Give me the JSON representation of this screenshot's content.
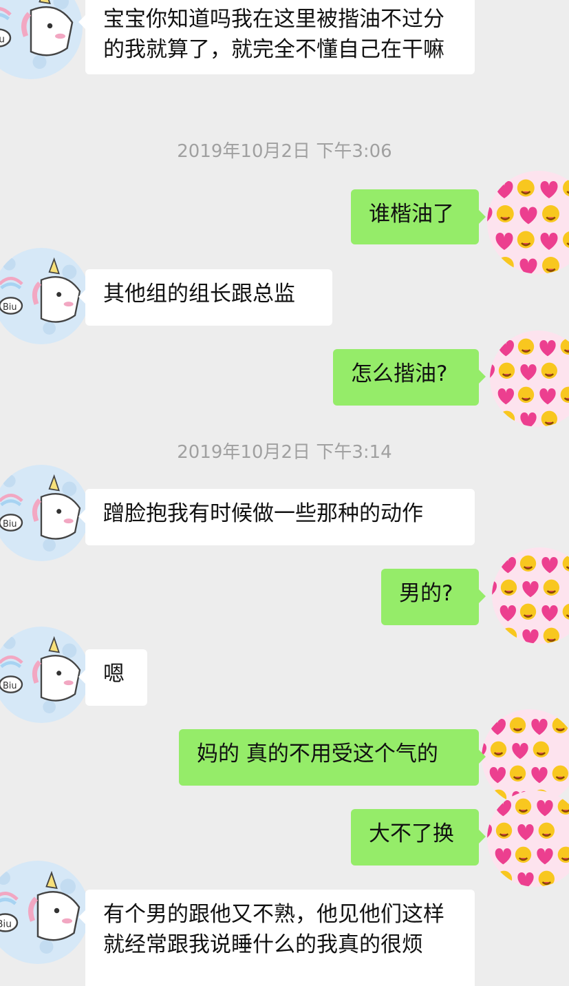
{
  "colors": {
    "background": "#ededed",
    "incoming_bubble": "#ffffff",
    "outgoing_bubble": "#95ec69",
    "timestamp_text": "#a0a0a0"
  },
  "avatars": {
    "contact": "unicorn-avatar-icon",
    "me": "heart-emoji-avatar-icon"
  },
  "messages": [
    {
      "side": "left",
      "text": "宝宝你知道吗我在这里被揩油不过分的我就算了，就完全不懂自己在干嘛"
    },
    {
      "type": "timestamp",
      "text": "2019年10月2日 下午3:06"
    },
    {
      "side": "right",
      "text": "谁楷油了"
    },
    {
      "side": "left",
      "text": "其他组的组长跟总监"
    },
    {
      "side": "right",
      "text": "怎么揩油?"
    },
    {
      "type": "timestamp",
      "text": "2019年10月2日 下午3:14"
    },
    {
      "side": "left",
      "text": "蹭脸抱我有时候做一些那种的动作"
    },
    {
      "side": "right",
      "text": "男的?"
    },
    {
      "side": "left",
      "text": "嗯"
    },
    {
      "side": "right",
      "text": "妈的 真的不用受这个气的"
    },
    {
      "side": "right",
      "text": "大不了换"
    },
    {
      "side": "left",
      "text": "有个男的跟他又不熟，他见他们这样就经常跟我说睡什么的我真的很烦"
    }
  ]
}
